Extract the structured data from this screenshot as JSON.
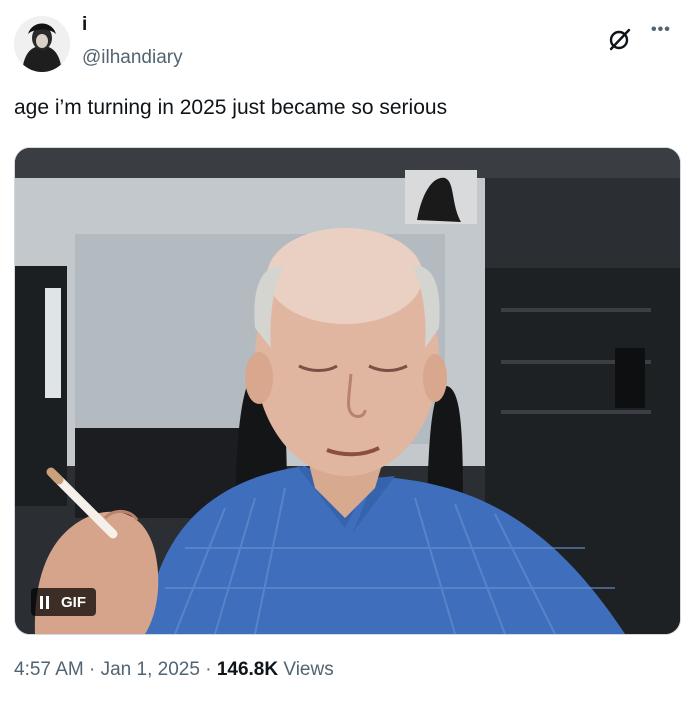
{
  "author": {
    "display_name": "i",
    "handle": "@ilhandiary"
  },
  "tweet": {
    "text": "age i’m turning in 2025 just became so serious"
  },
  "media": {
    "badge_label": "GIF"
  },
  "meta": {
    "time": "4:57 AM",
    "separator": "·",
    "date": "Jan 1, 2025",
    "views_count": "146.8K",
    "views_label": "Views"
  },
  "icons": {
    "grok": "grok-icon",
    "more": "more-icon",
    "pause": "pause-icon"
  },
  "colors": {
    "text_primary": "#0f1419",
    "text_secondary": "#536471",
    "shirt_blue": "#3f6fbc"
  }
}
